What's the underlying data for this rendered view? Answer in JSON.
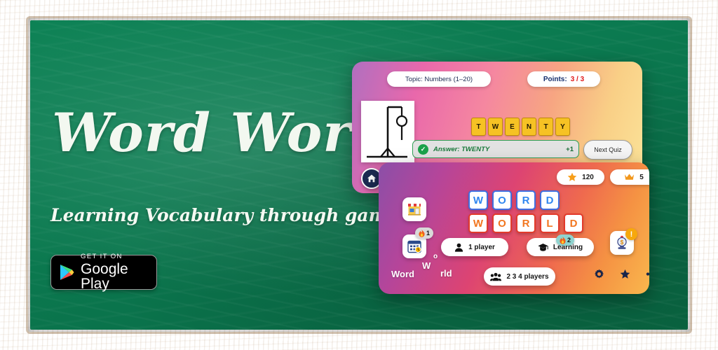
{
  "hero": {
    "title": "Word World",
    "subtitle": "Learning Vocabulary through games!",
    "store_badge": {
      "small_text": "GET IT ON",
      "big_text": "Google Play",
      "icon": "google-play-triangle-icon"
    }
  },
  "theme": {
    "board_green": "#0b7a50",
    "frame_wood": "#e6b67d",
    "quiz_card_gradient": [
      "#b06fc0",
      "#e968ab",
      "#f7a582",
      "#fbe49a"
    ],
    "home_card_gradient": [
      "#8b4fa8",
      "#dd4472",
      "#f59243",
      "#f9b74d"
    ],
    "tile_yellow": "#f6c224",
    "answer_green": "#1b7a3c",
    "points_red": "#e01b1b",
    "logo_blue": "#2f86f0",
    "logo_orange": "#f2761f"
  },
  "quiz_card": {
    "topic_label": "Topic: Numbers (1–20)",
    "points_label": "Points:",
    "points_value": "3 / 3",
    "hangman_icon": "hangman-gallows-icon",
    "word_tiles": [
      "T",
      "W",
      "E",
      "N",
      "T",
      "Y"
    ],
    "answer": {
      "check_icon": "check-circle-icon",
      "text": "Answer: TWENTY",
      "score_delta": "+1"
    },
    "next_button": "Next Quiz",
    "home_button_icon": "home-icon"
  },
  "home_card": {
    "stats": [
      {
        "icon": "star-icon",
        "value": "120"
      },
      {
        "icon": "crown-icon",
        "value": "5"
      }
    ],
    "logo": {
      "row1": [
        "W",
        "O",
        "R",
        "D"
      ],
      "row2": [
        "W",
        "O",
        "R",
        "L",
        "D"
      ]
    },
    "side_icons": [
      {
        "icon": "store-icon",
        "glyph": "🏪"
      },
      {
        "icon": "calendar-clock-icon",
        "glyph": "📅",
        "badge": {
          "icon": "flame-icon",
          "value": "1"
        }
      }
    ],
    "prize_icon": {
      "icon": "prize-machine-icon",
      "glyph": "🎰",
      "badge": {
        "icon": "alert-icon",
        "value": "!"
      }
    },
    "watermark": {
      "part1": "Word",
      "part2": "W",
      "part3": "o",
      "part4": "rld"
    },
    "mode_buttons": [
      {
        "icon": "person-icon",
        "label": "1 player"
      },
      {
        "icon": "graduation-cap-icon",
        "label": "Learning",
        "badge": {
          "icon": "flame-icon",
          "value": "2"
        }
      },
      {
        "icon": "group-icon",
        "label": "2 3 4 players"
      }
    ],
    "bottom_icons": [
      {
        "icon": "gear-icon"
      },
      {
        "icon": "star-icon"
      },
      {
        "icon": "share-icon"
      }
    ]
  }
}
